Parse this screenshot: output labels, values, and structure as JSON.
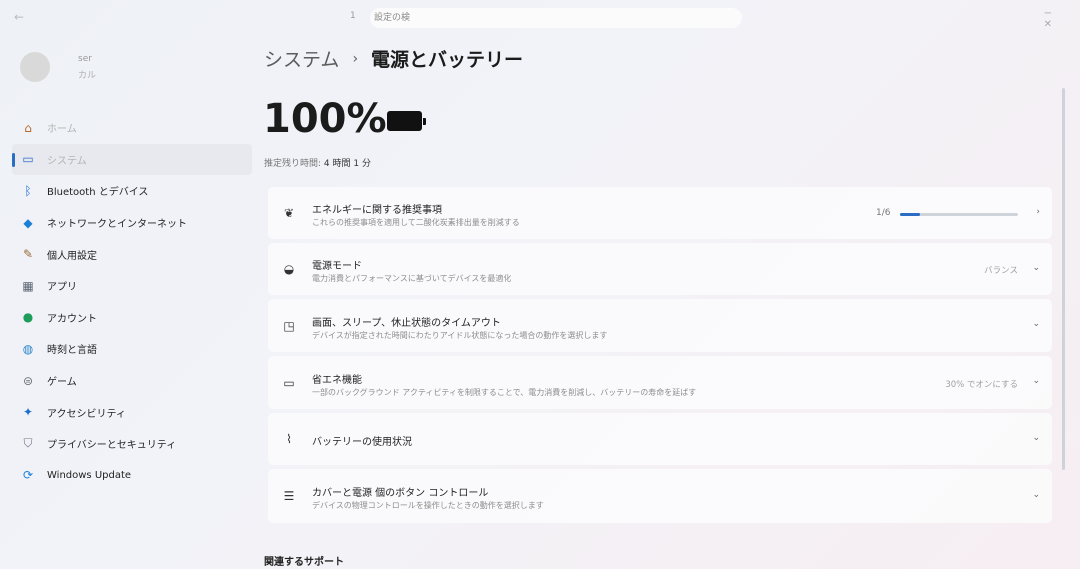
{
  "window": {
    "back_glyph": "←",
    "tab_number": "1",
    "search_text": "設定の検",
    "controls": "− ✕"
  },
  "profile": {
    "name": "ser",
    "email": "カル"
  },
  "sidebar": {
    "items": [
      {
        "label": "ホーム",
        "icon": "home-icon",
        "glyph": "⌂",
        "color": "#b76a2e"
      },
      {
        "label": "システム",
        "icon": "system-icon",
        "glyph": "▭",
        "color": "#2b6cc4",
        "selected": true
      },
      {
        "label": "Bluetooth とデバイス",
        "icon": "bluetooth-icon",
        "glyph": "ᛒ",
        "color": "#1f6fd1"
      },
      {
        "label": "ネットワークとインターネット",
        "icon": "wifi-icon",
        "glyph": "◆",
        "color": "#1c7fd6"
      },
      {
        "label": "個人用設定",
        "icon": "brush-icon",
        "glyph": "✎",
        "color": "#9a6a3a"
      },
      {
        "label": "アプリ",
        "icon": "apps-icon",
        "glyph": "▦",
        "color": "#5a6472"
      },
      {
        "label": "アカウント",
        "icon": "account-icon",
        "glyph": "●",
        "color": "#1e9c5a"
      },
      {
        "label": "時刻と言語",
        "icon": "globe-icon",
        "glyph": "◍",
        "color": "#2a86c9"
      },
      {
        "label": "ゲーム",
        "icon": "gamepad-icon",
        "glyph": "⊜",
        "color": "#6a7078"
      },
      {
        "label": "アクセシビリティ",
        "icon": "accessibility-icon",
        "glyph": "✦",
        "color": "#1f6fd1"
      },
      {
        "label": "プライバシーとセキュリティ",
        "icon": "shield-icon",
        "glyph": "⛉",
        "color": "#6d7480"
      },
      {
        "label": "Windows Update",
        "icon": "update-icon",
        "glyph": "⟳",
        "color": "#1c7fd6"
      }
    ]
  },
  "main": {
    "breadcrumb_parent": "システム",
    "breadcrumb_sep": "›",
    "breadcrumb_current": "電源とバッテリー",
    "battery_percent": "100%",
    "remaining_label": "推定残り時間:",
    "remaining_value": "4 時間 1 分",
    "cards": [
      {
        "title": "エネルギーに関する推奨事項",
        "desc": "これらの推奨事項を適用して二酸化炭素排出量を削減する",
        "icon": "leaf-icon",
        "glyph": "❦",
        "progress_text": "1/6",
        "progress": 0.1667
      },
      {
        "title": "電源モード",
        "desc": "電力消費とパフォーマンスに基づいてデバイスを最適化",
        "icon": "power-mode-icon",
        "glyph": "◒",
        "value": "バランス"
      },
      {
        "title": "画面、スリープ、休止状態のタイムアウト",
        "desc": "デバイスが指定された時間にわたりアイドル状態になった場合の動作を選択します",
        "icon": "screen-sleep-icon",
        "glyph": "◳"
      },
      {
        "title": "省エネ機能",
        "desc": "一部のバックグラウンド アクティビティを制限することで、電力消費を削減し、バッテリーの寿命を延ばす",
        "icon": "battery-saver-icon",
        "glyph": "▭",
        "value": "30% でオンにする"
      },
      {
        "title": "バッテリーの使用状況",
        "icon": "chart-icon",
        "glyph": "⌇"
      },
      {
        "title": "カバーと電源 個のボタン コントロール",
        "desc": "デバイスの物理コントロールを操作したときの動作を選択します",
        "icon": "buttons-list-icon",
        "glyph": "☰"
      }
    ],
    "related_support": "関連するサポート"
  }
}
